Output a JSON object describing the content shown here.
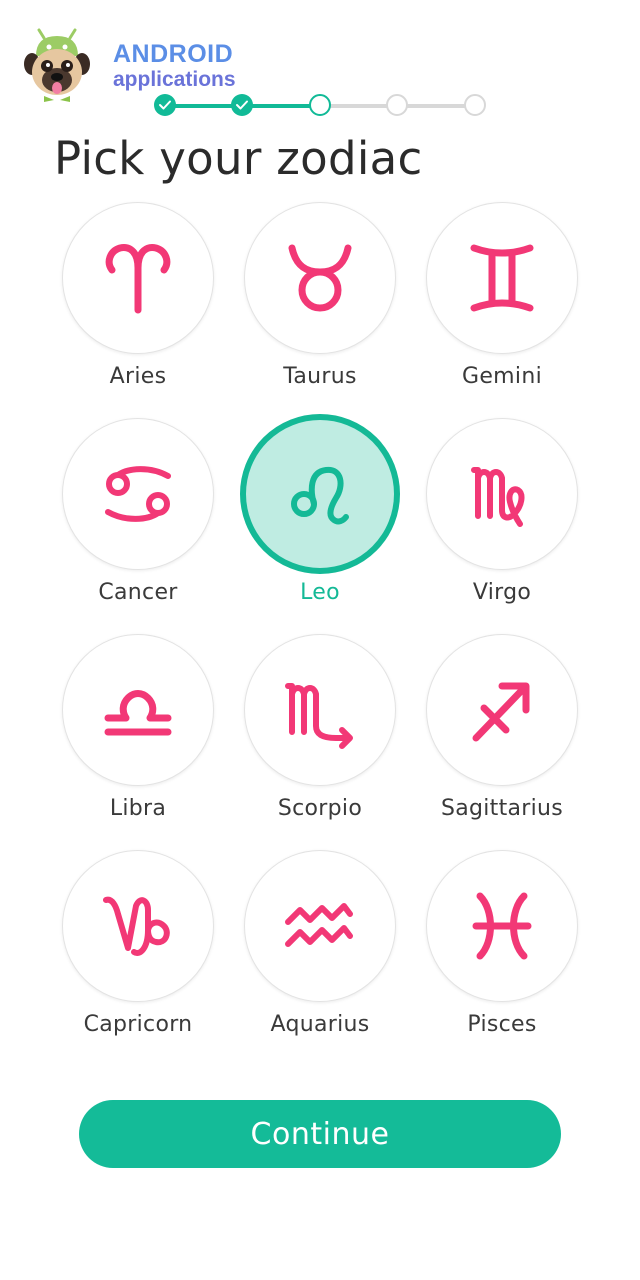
{
  "logo": {
    "line1": "ANDROID",
    "line2": "applications",
    "icon": "pug-android-icon"
  },
  "progress": {
    "total_steps": 5,
    "completed_steps": 2,
    "current_step": 3,
    "color_active": "#11ba97",
    "color_inactive": "#d8d8d8"
  },
  "title": "Pick your zodiac",
  "zodiacs": [
    {
      "label": "Aries",
      "icon": "aries-icon",
      "glyph": "♈",
      "selected": false
    },
    {
      "label": "Taurus",
      "icon": "taurus-icon",
      "glyph": "♉",
      "selected": false
    },
    {
      "label": "Gemini",
      "icon": "gemini-icon",
      "glyph": "♊",
      "selected": false
    },
    {
      "label": "Cancer",
      "icon": "cancer-icon",
      "glyph": "♋",
      "selected": false
    },
    {
      "label": "Leo",
      "icon": "leo-icon",
      "glyph": "♌",
      "selected": true
    },
    {
      "label": "Virgo",
      "icon": "virgo-icon",
      "glyph": "♍",
      "selected": false
    },
    {
      "label": "Libra",
      "icon": "libra-icon",
      "glyph": "♎",
      "selected": false
    },
    {
      "label": "Scorpio",
      "icon": "scorpio-icon",
      "glyph": "♏",
      "selected": false
    },
    {
      "label": "Sagittarius",
      "icon": "sagittarius-icon",
      "glyph": "♐",
      "selected": false
    },
    {
      "label": "Capricorn",
      "icon": "capricorn-icon",
      "glyph": "♑",
      "selected": false
    },
    {
      "label": "Aquarius",
      "icon": "aquarius-icon",
      "glyph": "♒",
      "selected": false
    },
    {
      "label": "Pisces",
      "icon": "pisces-icon",
      "glyph": "♓",
      "selected": false
    }
  ],
  "continue_label": "Continue",
  "colors": {
    "accent": "#14bb98",
    "symbol": "#f23876",
    "selected_fill": "#bfece2"
  }
}
